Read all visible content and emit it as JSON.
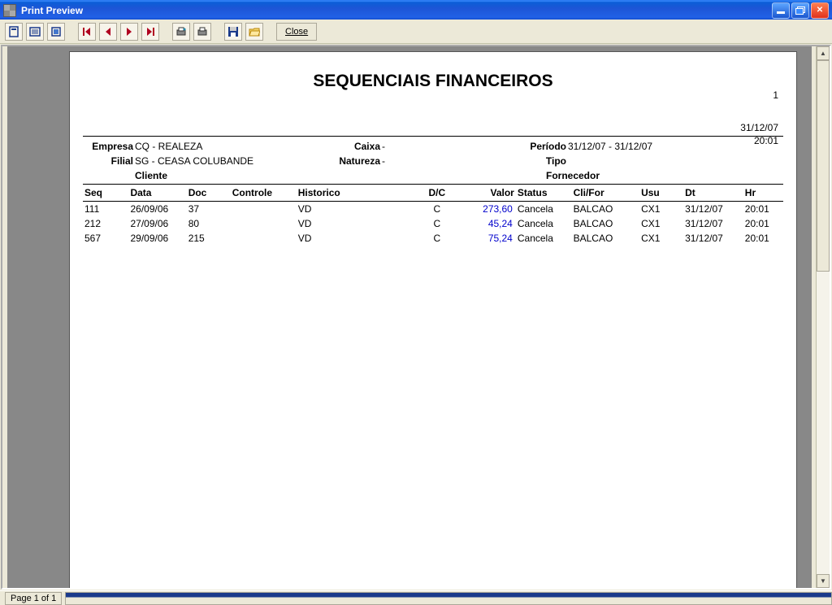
{
  "window": {
    "title": "Print Preview",
    "status": "Page 1 of 1"
  },
  "toolbar": {
    "close_label": "Close"
  },
  "report": {
    "title": "SEQUENCIAIS FINANCEIROS",
    "page_number": "1",
    "print_date": "31/12/07",
    "print_time": "20:01",
    "header": {
      "empresa_label": "Empresa",
      "empresa_value": "CQ - REALEZA",
      "filial_label": "Filial",
      "filial_value": "SG - CEASA COLUBANDE",
      "caixa_label": "Caixa",
      "caixa_value": "-",
      "natureza_label": "Natureza",
      "natureza_value": "-",
      "periodo_label": "Período",
      "periodo_value": "31/12/07 - 31/12/07",
      "tipo_label": "Tipo",
      "tipo_value": "",
      "cliente_label": "Cliente",
      "fornecedor_label": "Fornecedor"
    },
    "columns": {
      "seq": "Seq",
      "data": "Data",
      "doc": "Doc",
      "controle": "Controle",
      "historico": "Historico",
      "dc": "D/C",
      "valor": "Valor",
      "status": "Status",
      "clifor": "Cli/For",
      "usu": "Usu",
      "dt": "Dt",
      "hr": "Hr"
    },
    "rows": [
      {
        "seq": "111",
        "data": "26/09/06",
        "doc": "37",
        "controle": "",
        "historico": "VD",
        "dc": "C",
        "valor": "273,60",
        "status": "Cancela",
        "clifor": "BALCAO",
        "usu": "CX1",
        "dt": "31/12/07",
        "hr": "20:01"
      },
      {
        "seq": "212",
        "data": "27/09/06",
        "doc": "80",
        "controle": "",
        "historico": "VD",
        "dc": "C",
        "valor": "45,24",
        "status": "Cancela",
        "clifor": "BALCAO",
        "usu": "CX1",
        "dt": "31/12/07",
        "hr": "20:01"
      },
      {
        "seq": "567",
        "data": "29/09/06",
        "doc": "215",
        "controle": "",
        "historico": "VD",
        "dc": "C",
        "valor": "75,24",
        "status": "Cancela",
        "clifor": "BALCAO",
        "usu": "CX1",
        "dt": "31/12/07",
        "hr": "20:01"
      }
    ]
  }
}
